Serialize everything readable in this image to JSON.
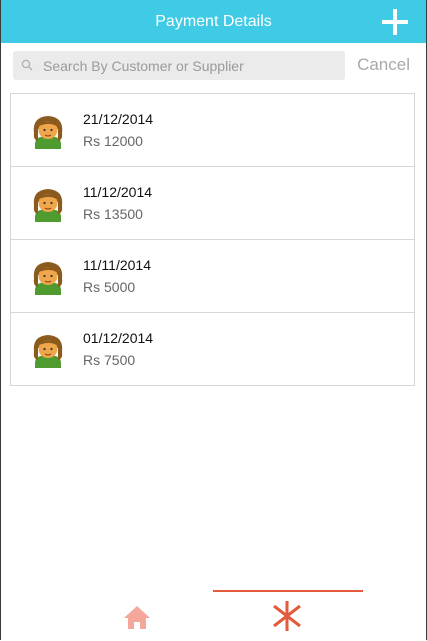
{
  "header": {
    "title": "Payment Details",
    "add_icon": "plus-icon"
  },
  "search": {
    "placeholder": "Search By Customer or Supplier",
    "value": "",
    "icon": "search-icon",
    "cancel_label": "Cancel"
  },
  "payments": [
    {
      "date": "21/12/2014",
      "amount": "Rs 12000",
      "avatar": "customer-avatar"
    },
    {
      "date": "11/12/2014",
      "amount": "Rs 13500",
      "avatar": "customer-avatar"
    },
    {
      "date": "11/11/2014",
      "amount": "Rs 5000",
      "avatar": "customer-avatar"
    },
    {
      "date": "01/12/2014",
      "amount": "Rs 7500",
      "avatar": "customer-avatar"
    }
  ],
  "tabbar": {
    "tabs": [
      {
        "icon": "home-icon",
        "active": false
      },
      {
        "icon": "asterisk-icon",
        "active": true
      }
    ]
  },
  "colors": {
    "header_bg": "#3fcbe6",
    "accent": "#e35a3c",
    "home_inactive": "#f4a79a"
  }
}
